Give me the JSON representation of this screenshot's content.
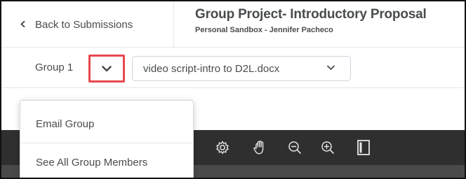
{
  "header": {
    "back_label": "Back to Submissions",
    "title": "Group Project- Introductory Proposal",
    "subtitle": "Personal Sandbox - Jennifer Pacheco"
  },
  "toolbar": {
    "group_label": "Group 1",
    "group_toggle_icon": "chevron-down-icon",
    "file_select_value": "video script-intro to D2L.docx"
  },
  "menu": {
    "items": [
      {
        "label": "Email Group"
      },
      {
        "label": "See All Group Members"
      }
    ]
  },
  "viewer_toolbar": {
    "tools": [
      "settings-icon",
      "hand-pan-icon",
      "zoom-out-icon",
      "zoom-in-icon",
      "fit-page-icon"
    ]
  },
  "colors": {
    "highlight_border": "#e8474e",
    "viewer_bar": "#2f2f2f",
    "text": "#494c4e"
  }
}
